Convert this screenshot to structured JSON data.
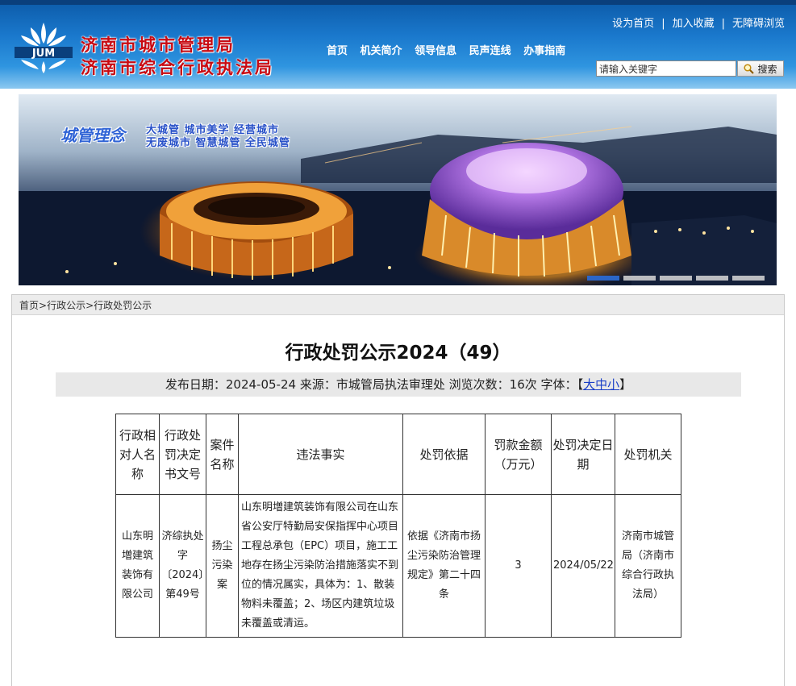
{
  "header": {
    "logo_text": "JUM",
    "title_line1": "济南市城市管理局",
    "title_line2": "济南市综合行政执法局",
    "top_links": [
      "设为首页",
      "加入收藏",
      "无障碍浏览"
    ],
    "nav": [
      "首页",
      "机关简介",
      "领导信息",
      "民声连线",
      "办事指南"
    ],
    "search": {
      "placeholder": "请输入关键字",
      "value": "请输入关键字",
      "button_label": "搜索"
    }
  },
  "banner": {
    "slogan_label": "城管理念",
    "slogan_line1": "大城管 城市美学 经营城市",
    "slogan_line2": "无废城市 智慧城管 全民城管",
    "slide_count": 5,
    "active_slide": 1
  },
  "breadcrumb": [
    "首页",
    "行政公示",
    "行政处罚公示"
  ],
  "article": {
    "title": "行政处罚公示2024（49）",
    "meta": {
      "date_label": "发布日期：",
      "date": "2024-05-24",
      "source_label": "来源：",
      "source": "市城管局执法审理处",
      "views_label": "浏览次数：",
      "views": "16次",
      "font_label": "字体：",
      "font_open": "【",
      "font_sizes": [
        "大",
        "中",
        "小"
      ],
      "font_close": "】"
    },
    "table": {
      "headers": [
        "行政相对人名称",
        "行政处罚决定书文号",
        "案件名称",
        "违法事实",
        "处罚依据",
        "罚款金额（万元）",
        "处罚决定日期",
        "处罚机关"
      ],
      "rows": [
        [
          "山东明増建筑装饰有限公司",
          "济综执处字〔2024〕第49号",
          "扬尘污染案",
          "山东明増建筑装饰有限公司在山东省公安厅特勤局安保指挥中心项目工程总承包（EPC）项目，施工工地存在扬尘污染防治措施落实不到位的情况属实，具体为：1、散装物料未覆盖；2、场区内建筑垃圾未覆盖或清运。",
          "依据《济南市扬尘污染防治管理规定》第二十四条",
          "3",
          "2024/05/22",
          "济南市城管局（济南市综合行政执法局）"
        ]
      ]
    }
  },
  "colors": {
    "header_blue": "#1a78cc",
    "title_red": "#c80a12",
    "link_blue": "#1a3fc7",
    "meta_bg": "#e8e8e8"
  }
}
